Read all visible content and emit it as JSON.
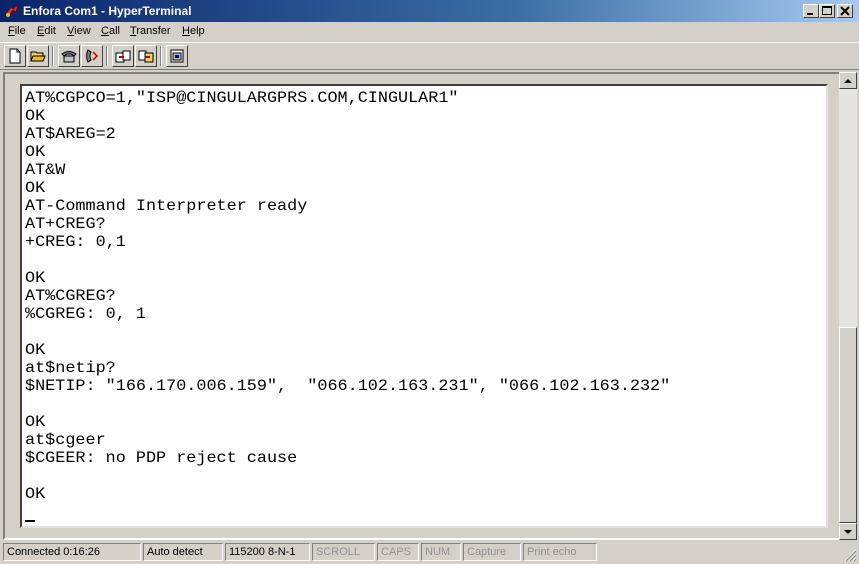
{
  "window": {
    "title": "Enfora Com1 - HyperTerminal",
    "controls": {
      "minimize": "minimize",
      "maximize": "maximize",
      "close": "close"
    }
  },
  "menu": [
    "File",
    "Edit",
    "View",
    "Call",
    "Transfer",
    "Help"
  ],
  "toolbar": {
    "icons": [
      "new-document-icon",
      "open-folder-icon",
      "phone-connect-icon",
      "phone-disconnect-icon",
      "send-file-icon",
      "receive-file-icon",
      "properties-icon"
    ]
  },
  "terminal": {
    "lines": [
      "AT%CGPCO=1,\"ISP@CINGULARGPRS.COM,CINGULAR1\"",
      "OK",
      "AT$AREG=2",
      "OK",
      "AT&W",
      "OK",
      "AT-Command Interpreter ready",
      "AT+CREG?",
      "+CREG: 0,1",
      "",
      "OK",
      "AT%CGREG?",
      "%CGREG: 0, 1",
      "",
      "OK",
      "at$netip?",
      "$NETIP: \"166.170.006.159\",  \"066.102.163.231\", \"066.102.163.232\"",
      "",
      "OK",
      "at$cgeer",
      "$CGEER: no PDP reject cause",
      "",
      "OK"
    ]
  },
  "statusbar": {
    "connected": "Connected 0:16:26",
    "detect": "Auto detect",
    "settings": "115200 8-N-1",
    "scroll": "SCROLL",
    "caps": "CAPS",
    "num": "NUM",
    "capture": "Capture",
    "print_echo": "Print echo"
  }
}
